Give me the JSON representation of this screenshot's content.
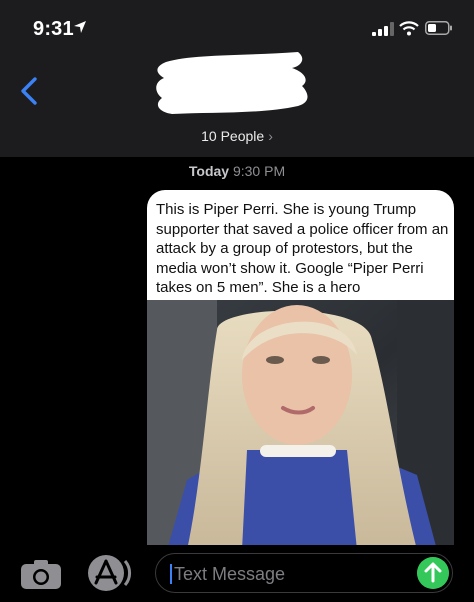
{
  "status_bar": {
    "time": "9:31"
  },
  "header": {
    "recipients_label": "10 People",
    "chevron": "›"
  },
  "conversation": {
    "timestamp_day": "Today",
    "timestamp_time": "9:30 PM",
    "message_text": "This is Piper Perri. She is young Trump\nsupporter that saved a police officer from an\nattack by a group of protestors, but the\nmedia won’t show it. Google “Piper Perri\ntakes on 5 men”. She is a hero"
  },
  "compose": {
    "placeholder": "Text Message"
  },
  "colors": {
    "accent_blue": "#3b82f6",
    "send_green": "#34c759",
    "header_bg": "#1c1c1e"
  }
}
